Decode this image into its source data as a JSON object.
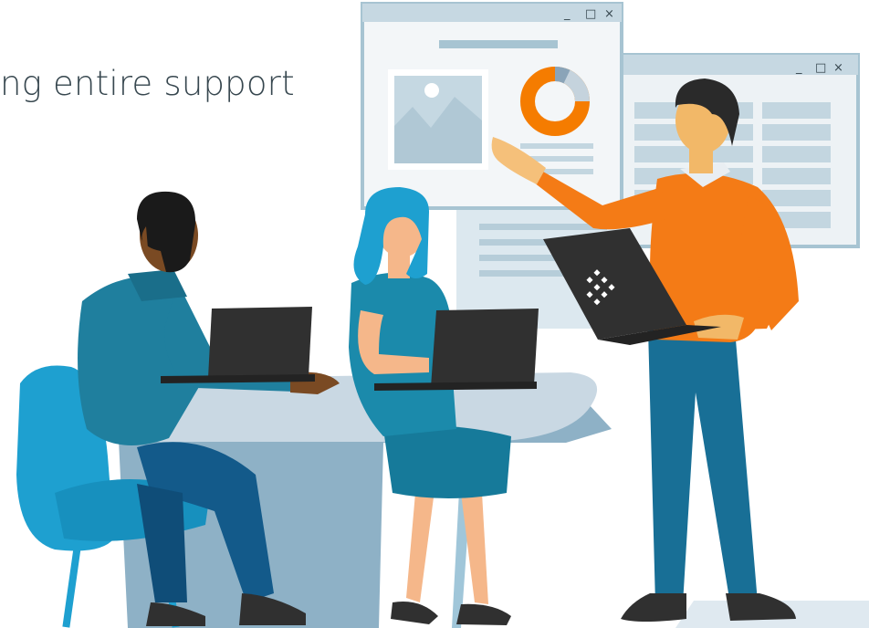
{
  "headline": "ng entire support",
  "window_front": {
    "controls": [
      "_",
      "□",
      "×"
    ]
  },
  "window_back": {
    "controls": [
      "_",
      "□",
      "×"
    ]
  },
  "icons": [
    "image-placeholder-icon",
    "donut-chart-icon",
    "laptop-logo-icon"
  ],
  "colors": {
    "window_frame": "#a7c4d2",
    "window_body": "#edf2f5",
    "donut": "#f57c00",
    "sweater": "#f47b16",
    "teal_shirt": "#1f7f9e",
    "chair": "#1ea0d0",
    "table": "#c9d8e3",
    "laptop": "#303030"
  }
}
